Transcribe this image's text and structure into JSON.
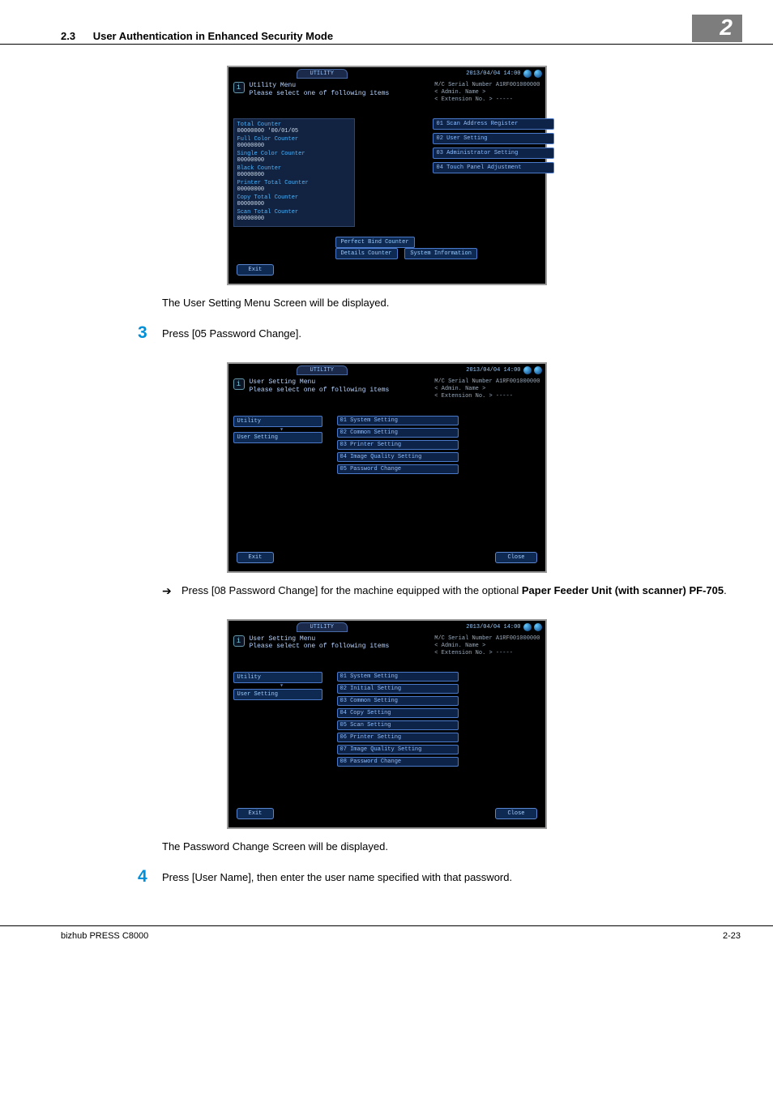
{
  "header": {
    "section_number": "2.3",
    "section_title": "User Authentication in Enhanced Security Mode",
    "chapter_badge": "2"
  },
  "panel_common": {
    "tab_label": "UTILITY",
    "timestamp": "2013/04/04 14:00",
    "serial_label": "M/C Serial Number",
    "serial_value": "A1RF001000000",
    "admin_label": "< Admin. Name >",
    "ext_label": "< Extension No. >",
    "ext_value": "-----",
    "info_title": "Please select one of following items",
    "exit_label": "Exit",
    "close_label": "Close"
  },
  "panel1": {
    "title": "Utility Menu",
    "counters": {
      "total_label": "Total Counter",
      "total_value": "00000000   '00/01/05",
      "full_color_label": "Full Color Counter",
      "full_color_value": "00000000",
      "single_color_label": "Single Color Counter",
      "single_color_value": "00000000",
      "black_label": "Black Counter",
      "black_value": "00000000",
      "printer_total_label": "Printer Total Counter",
      "printer_total_value": "00000000",
      "copy_total_label": "Copy Total Counter",
      "copy_total_value": "00000000",
      "scan_total_label": "Scan Total Counter",
      "scan_total_value": "00000000"
    },
    "mini_buttons": {
      "perfect_bind": "Perfect Bind Counter",
      "details": "Details Counter",
      "sysinfo": "System Information"
    },
    "menu": {
      "i01": "01 Scan Address Register",
      "i02": "02 User Setting",
      "i03": "03 Administrator Setting",
      "i04": "04 Touch Panel Adjustment"
    }
  },
  "caption1": "The User Setting Menu Screen will be displayed.",
  "step3": {
    "num": "3",
    "text": "Press [05 Password Change]."
  },
  "panel2": {
    "title": "User Setting Menu",
    "crumbs": {
      "utility": "Utility",
      "user_setting": "User Setting"
    },
    "menu": {
      "i01": "01 System Setting",
      "i02": "02 Common Setting",
      "i03": "03 Printer Setting",
      "i04": "04 Image Quality Setting",
      "i05": "05 Password Change"
    }
  },
  "bullet1_a": "Press [08 Password Change] for the machine equipped with the optional ",
  "bullet1_b": "Paper Feeder Unit (with scanner) PF-705",
  "bullet1_c": ".",
  "panel3": {
    "title": "User Setting Menu",
    "crumbs": {
      "utility": "Utility",
      "user_setting": "User Setting"
    },
    "menu": {
      "i01": "01 System Setting",
      "i02": "02 Initial Setting",
      "i03": "03 Common Setting",
      "i04": "04 Copy Setting",
      "i05": "05 Scan Setting",
      "i06": "06 Printer Setting",
      "i07": "07 Image Quality Setting",
      "i08": "08 Password Change"
    }
  },
  "caption2": "The Password Change Screen will be displayed.",
  "step4": {
    "num": "4",
    "text": "Press [User Name], then enter the user name specified with that password."
  },
  "footer": {
    "product": "bizhub PRESS C8000",
    "page": "2-23"
  }
}
